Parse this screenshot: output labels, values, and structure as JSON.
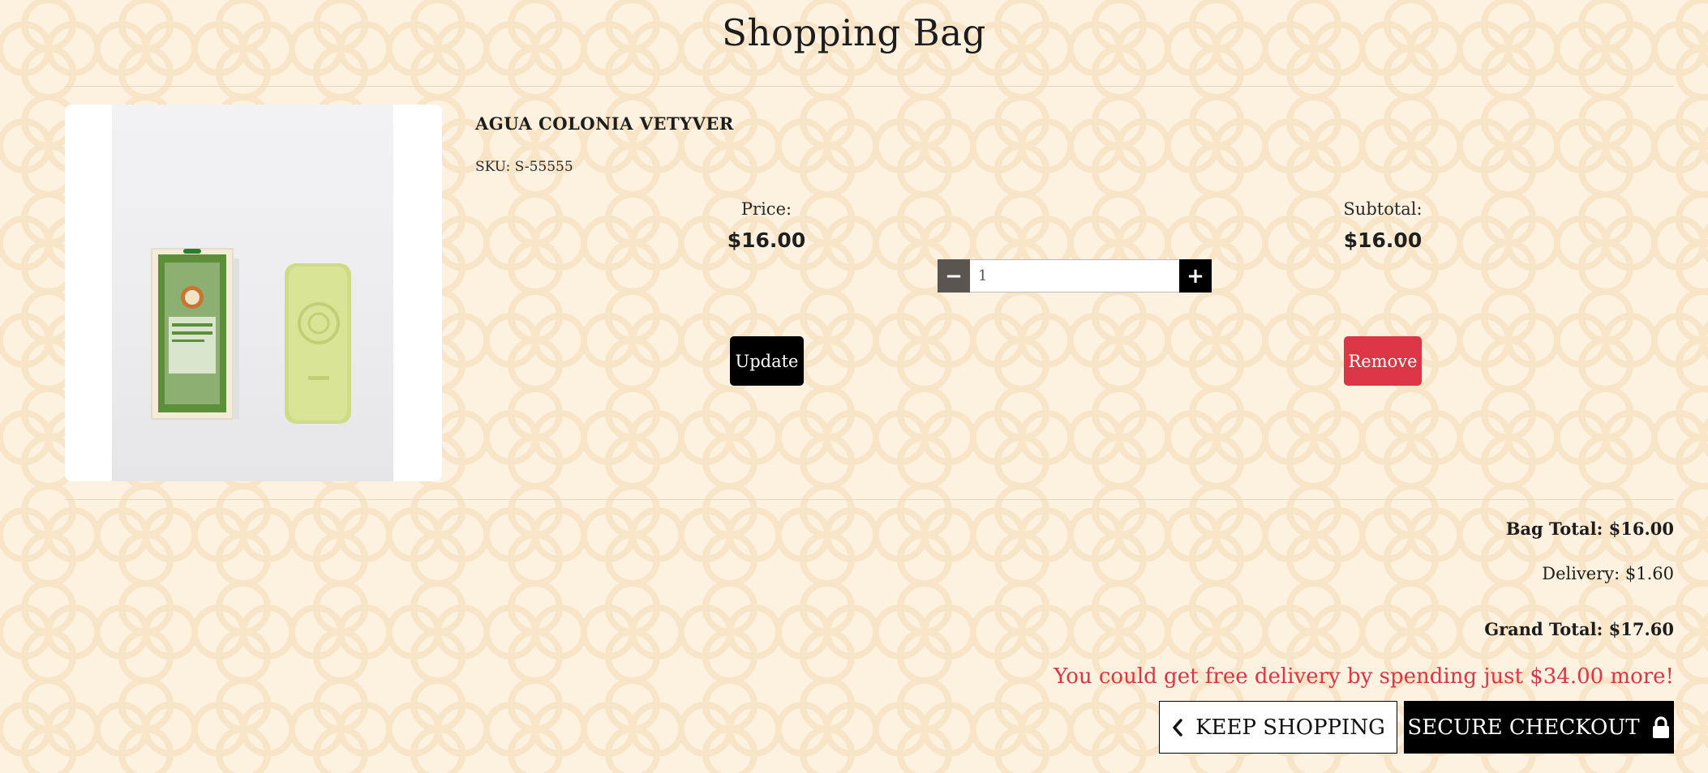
{
  "page": {
    "title": "Shopping Bag"
  },
  "item": {
    "name": "AGUA COLONIA VETYVER",
    "sku": "SKU: S-55555",
    "price_label": "Price:",
    "price": "$16.00",
    "subtotal_label": "Subtotal:",
    "subtotal": "$16.00",
    "quantity": "1",
    "update_label": "Update",
    "remove_label": "Remove",
    "image_alt": "AGUA COLONIA VETYVER product with soap"
  },
  "summary": {
    "bag_total": "Bag Total: $16.00",
    "delivery": "Delivery: $1.60",
    "grand_total": "Grand Total: $17.60",
    "free_delivery_message": "You could get free delivery by spending just $34.00 more!"
  },
  "actions": {
    "keep_shopping": "KEEP SHOPPING",
    "secure_checkout": "SECURE CHECKOUT"
  },
  "icons": {
    "minus": "minus-icon",
    "plus": "plus-icon",
    "chevron_left": "chevron-left-icon",
    "lock": "lock-icon"
  },
  "colors": {
    "background": "#fdf1df",
    "pattern": "#f6dfbf",
    "remove": "#dc3545",
    "free_delivery_text": "#dc3545",
    "primary_button": "#000000",
    "minus_button": "#5a5550"
  }
}
